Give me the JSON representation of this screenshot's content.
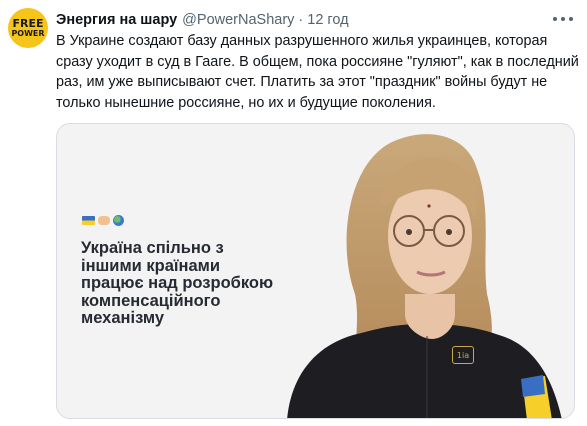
{
  "tweet": {
    "avatar_text_line1": "FREE",
    "avatar_text_line2": "POWER",
    "display_name": "Энергия на шару",
    "handle": "@PowerNaShary",
    "separator": "·",
    "time": "12 год",
    "text": "В Украине создают базу данных разрушенного жилья украинцев, которая сразу уходит в суд в Гааге. В общем, пока россияне \"гуляют\", как в последний раз, им уже выписывают счет. Платить за этот \"праздник\" войны будут не только нынешние россияне, но их и будущие поколения."
  },
  "media": {
    "caption": "Україна спільно з іншими країнами працює над розробкою компенсаційного механізму",
    "badge_text": "1ia",
    "icons": [
      "ukraine-flag-icon",
      "handshake-icon",
      "globe-icon"
    ]
  },
  "colors": {
    "avatar_bg": "#f6c51a",
    "secondary_text": "#536471",
    "primary_text": "#0f1419",
    "card_border": "#d7dde2"
  }
}
